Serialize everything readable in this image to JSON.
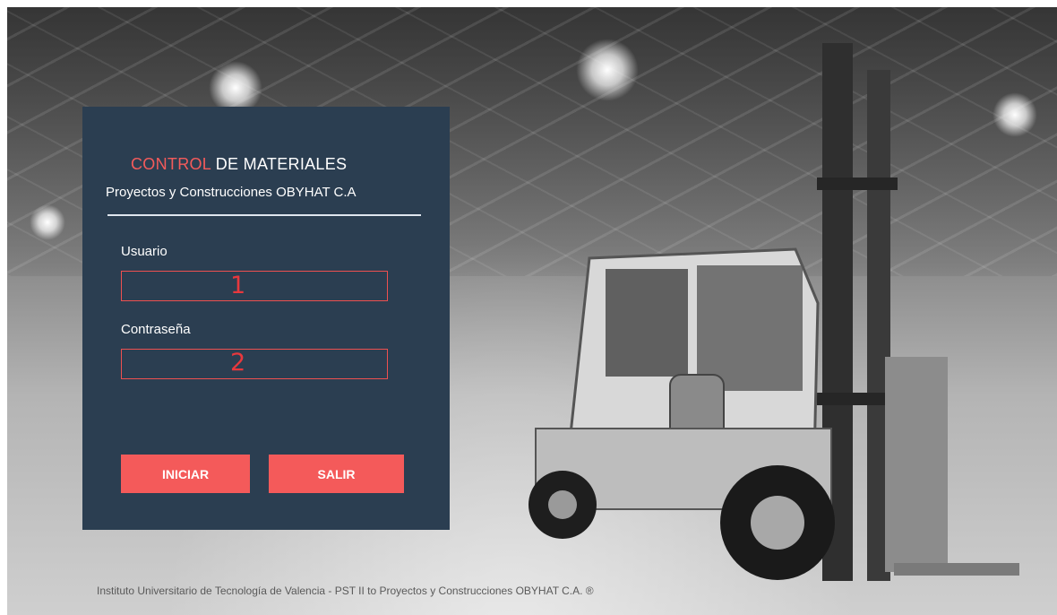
{
  "panel": {
    "title_accent": "CONTROL",
    "title_rest": "DE  MATERIALES",
    "subtitle": "Proyectos y Construcciones OBYHAT C.A"
  },
  "form": {
    "username_label": "Usuario",
    "username_value": "",
    "username_marker": "1",
    "password_label": "Contraseña",
    "password_value": "",
    "password_marker": "2"
  },
  "buttons": {
    "start_label": "INICIAR",
    "exit_label": "SALIR"
  },
  "footer": {
    "text": "Instituto Universitario de Tecnología de Valencia - PST II  to  Proyectos y Construcciones OBYHAT C.A. ®"
  },
  "colors": {
    "panel": "#2b3e51",
    "accent": "#f45a5a",
    "field_border": "#ee5050"
  }
}
